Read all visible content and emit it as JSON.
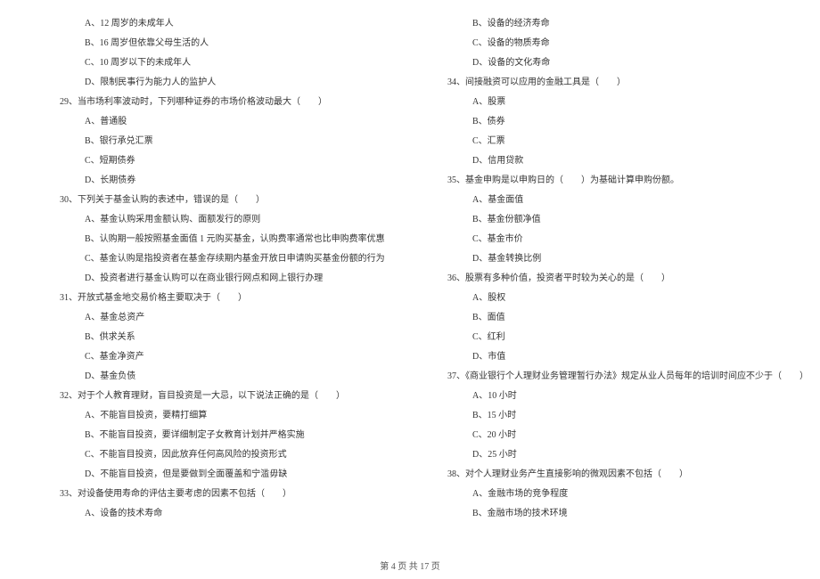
{
  "left_column": [
    {
      "type": "option",
      "text": "A、12 周岁的未成年人"
    },
    {
      "type": "option",
      "text": "B、16 周岁但依靠父母生活的人"
    },
    {
      "type": "option",
      "text": "C、10 周岁以下的未成年人"
    },
    {
      "type": "option",
      "text": "D、限制民事行为能力人的监护人"
    },
    {
      "type": "question",
      "text": "29、当市场利率波动时，下列哪种证券的市场价格波动最大（　　）"
    },
    {
      "type": "option",
      "text": "A、普通股"
    },
    {
      "type": "option",
      "text": "B、银行承兑汇票"
    },
    {
      "type": "option",
      "text": "C、短期债券"
    },
    {
      "type": "option",
      "text": "D、长期债券"
    },
    {
      "type": "question",
      "text": "30、下列关于基金认购的表述中，错误的是（　　）"
    },
    {
      "type": "option",
      "text": "A、基金认购采用金额认购、面额发行的原则"
    },
    {
      "type": "option",
      "text": "B、认购期一般按照基金面值 1 元购买基金，认购费率通常也比申购费率优惠"
    },
    {
      "type": "option",
      "text": "C、基金认购是指投资者在基金存续期内基金开放日申请购买基金份额的行为"
    },
    {
      "type": "option",
      "text": "D、投资者进行基金认购可以在商业银行网点和网上银行办理"
    },
    {
      "type": "question",
      "text": "31、开放式基金地交易价格主要取决于（　　）"
    },
    {
      "type": "option",
      "text": "A、基金总资产"
    },
    {
      "type": "option",
      "text": "B、供求关系"
    },
    {
      "type": "option",
      "text": "C、基金净资产"
    },
    {
      "type": "option",
      "text": "D、基金负债"
    },
    {
      "type": "question",
      "text": "32、对于个人教育理财，盲目投资是一大忌，以下说法正确的是（　　）"
    },
    {
      "type": "option",
      "text": "A、不能盲目投资，要精打细算"
    },
    {
      "type": "option",
      "text": "B、不能盲目投资，要详细制定子女教育计划并严格实施"
    },
    {
      "type": "option",
      "text": "C、不能盲目投资，因此放弃任何高风险的投资形式"
    },
    {
      "type": "option",
      "text": "D、不能盲目投资，但是要做到全面覆盖和宁滥毋缺"
    },
    {
      "type": "question",
      "text": "33、对设备使用寿命的评估主要考虑的因素不包括（　　）"
    },
    {
      "type": "option",
      "text": "A、设备的技术寿命"
    }
  ],
  "right_column": [
    {
      "type": "option",
      "text": "B、设备的经济寿命"
    },
    {
      "type": "option",
      "text": "C、设备的物质寿命"
    },
    {
      "type": "option",
      "text": "D、设备的文化寿命"
    },
    {
      "type": "question",
      "text": "34、间接融资可以应用的金融工具是（　　）"
    },
    {
      "type": "option",
      "text": "A、股票"
    },
    {
      "type": "option",
      "text": "B、债券"
    },
    {
      "type": "option",
      "text": "C、汇票"
    },
    {
      "type": "option",
      "text": "D、信用贷款"
    },
    {
      "type": "question",
      "text": "35、基金申购是以申购日的（　　）为基础计算申购份额。"
    },
    {
      "type": "option",
      "text": "A、基金面值"
    },
    {
      "type": "option",
      "text": "B、基金份额净值"
    },
    {
      "type": "option",
      "text": "C、基金市价"
    },
    {
      "type": "option",
      "text": "D、基金转换比例"
    },
    {
      "type": "question",
      "text": "36、股票有多种价值，投资者平时较为关心的是（　　）"
    },
    {
      "type": "option",
      "text": "A、股权"
    },
    {
      "type": "option",
      "text": "B、面值"
    },
    {
      "type": "option",
      "text": "C、红利"
    },
    {
      "type": "option",
      "text": "D、市值"
    },
    {
      "type": "question",
      "text": "37、《商业银行个人理财业务管理暂行办法》规定从业人员每年的培训时间应不少于（　　）"
    },
    {
      "type": "option",
      "text": "A、10 小时"
    },
    {
      "type": "option",
      "text": "B、15 小时"
    },
    {
      "type": "option",
      "text": "C、20 小时"
    },
    {
      "type": "option",
      "text": "D、25 小时"
    },
    {
      "type": "question",
      "text": "38、对个人理财业务产生直接影响的微观因素不包括（　　）"
    },
    {
      "type": "option",
      "text": "A、金融市场的竞争程度"
    },
    {
      "type": "option",
      "text": "B、金融市场的技术环境"
    }
  ],
  "footer": "第 4 页 共 17 页"
}
